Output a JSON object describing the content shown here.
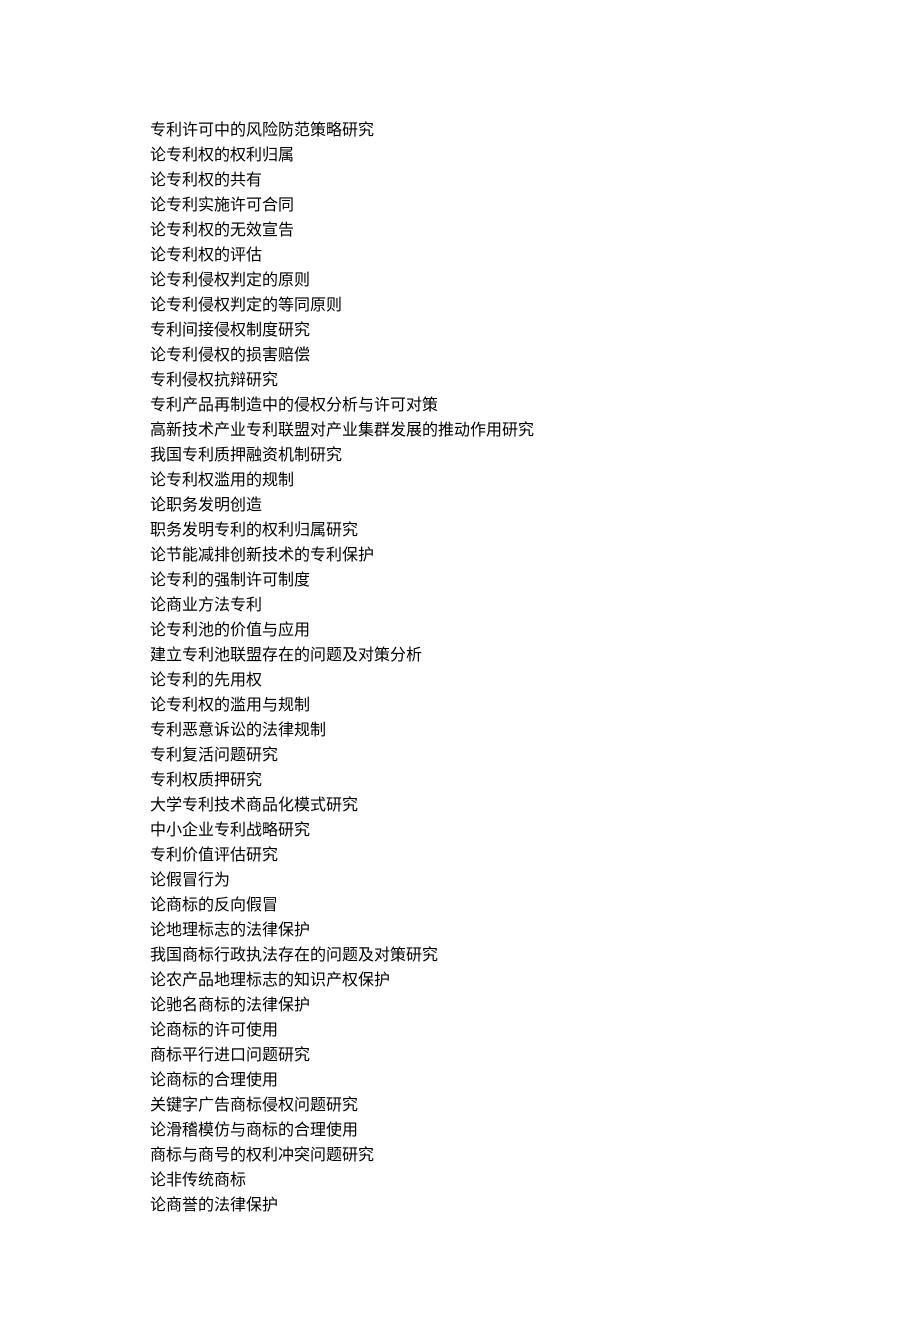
{
  "lines": [
    "专利许可中的风险防范策略研究",
    "论专利权的权利归属",
    "论专利权的共有",
    "论专利实施许可合同",
    "论专利权的无效宣告",
    "论专利权的评估",
    "论专利侵权判定的原则",
    "论专利侵权判定的等同原则",
    "专利间接侵权制度研究",
    "论专利侵权的损害赔偿",
    "专利侵权抗辩研究",
    "专利产品再制造中的侵权分析与许可对策",
    "高新技术产业专利联盟对产业集群发展的推动作用研究",
    "我国专利质押融资机制研究",
    "论专利权滥用的规制",
    "论职务发明创造",
    "职务发明专利的权利归属研究",
    "论节能减排创新技术的专利保护",
    "论专利的强制许可制度",
    "论商业方法专利",
    "论专利池的价值与应用",
    "建立专利池联盟存在的问题及对策分析",
    "论专利的先用权",
    "论专利权的滥用与规制",
    "专利恶意诉讼的法律规制",
    "专利复活问题研究",
    "专利权质押研究",
    "大学专利技术商品化模式研究",
    "中小企业专利战略研究",
    "专利价值评估研究",
    "论假冒行为",
    "论商标的反向假冒",
    "论地理标志的法律保护",
    "我国商标行政执法存在的问题及对策研究",
    "论农产品地理标志的知识产权保护",
    "论驰名商标的法律保护",
    "论商标的许可使用",
    "商标平行进口问题研究",
    "论商标的合理使用",
    "关键字广告商标侵权问题研究",
    "论滑稽模仿与商标的合理使用",
    "商标与商号的权利冲突问题研究",
    "论非传统商标",
    "论商誉的法律保护"
  ]
}
